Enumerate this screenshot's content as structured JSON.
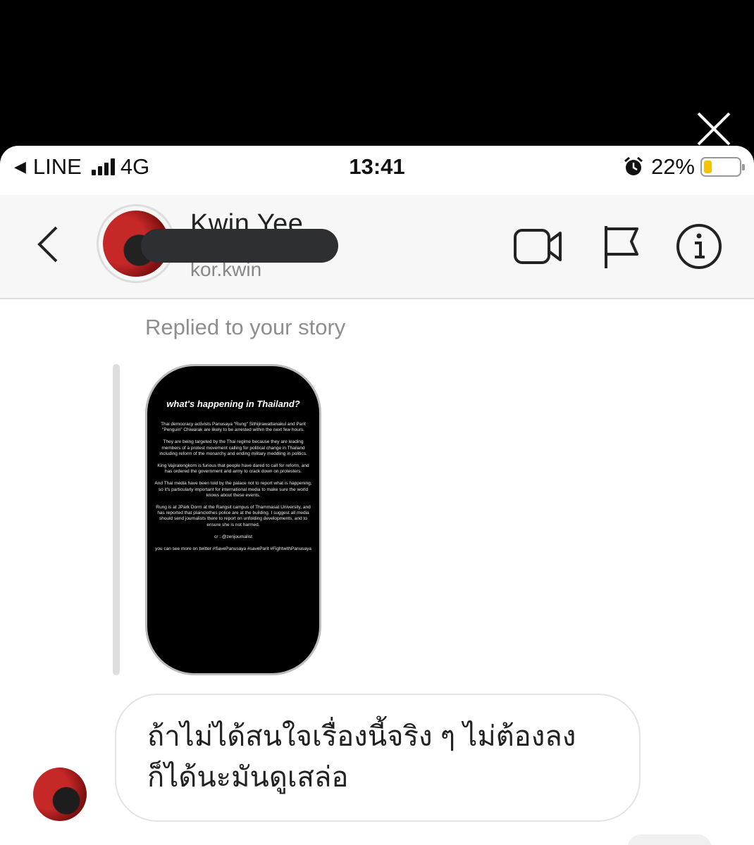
{
  "status_bar": {
    "carrier": "LINE",
    "network": "4G",
    "time": "13:41",
    "battery": "22%",
    "battery_level": 0.22,
    "battery_color": "#f5c400"
  },
  "header": {
    "name": "Kwin Yee",
    "username": "kor.kwin",
    "icons": [
      "back-chevron-icon",
      "video-call-icon",
      "flag-icon",
      "info-icon"
    ]
  },
  "conversation": {
    "reply_label": "Replied to your story",
    "story": {
      "title": "what's happening in Thailand?",
      "paragraphs": [
        "Thai democracy activists Panusaya \"Rung\" Sithijirawattanakul and Parit \"Penguin\" Chiwarak are likely to be arrested within the next few hours.",
        "They are being targeted by the Thai regime because they are leading members of a protest movement calling for political change in Thailand including reform of the monarchy and ending military meddling in politics.",
        "King Vajiralongkorn is furious that people have dared to call for reform, and has ordered the government and army to crack down on protesters.",
        "And Thai media have been told by the palace not to report what is happening, so it's particularly important for international media to make sure the world knows about these events.",
        "Rung is at JPark Dorm at the Rangsit campus of Thammasat University, and has reported that plainclothes police are at the building. I suggest all media should send journalists there to report on unfolding developments, and to ensure she is not harmed.",
        "cr : @zenjournalist",
        "you can see more on twitter #SavePanusaya #saveParit #FightwithPanusaya"
      ]
    },
    "message": "ถ้าไม่ได้สนใจเรื่องนี้จริง ๆ ไม่ต้องลง ก็ได้นะมันดูเสล่อ"
  }
}
